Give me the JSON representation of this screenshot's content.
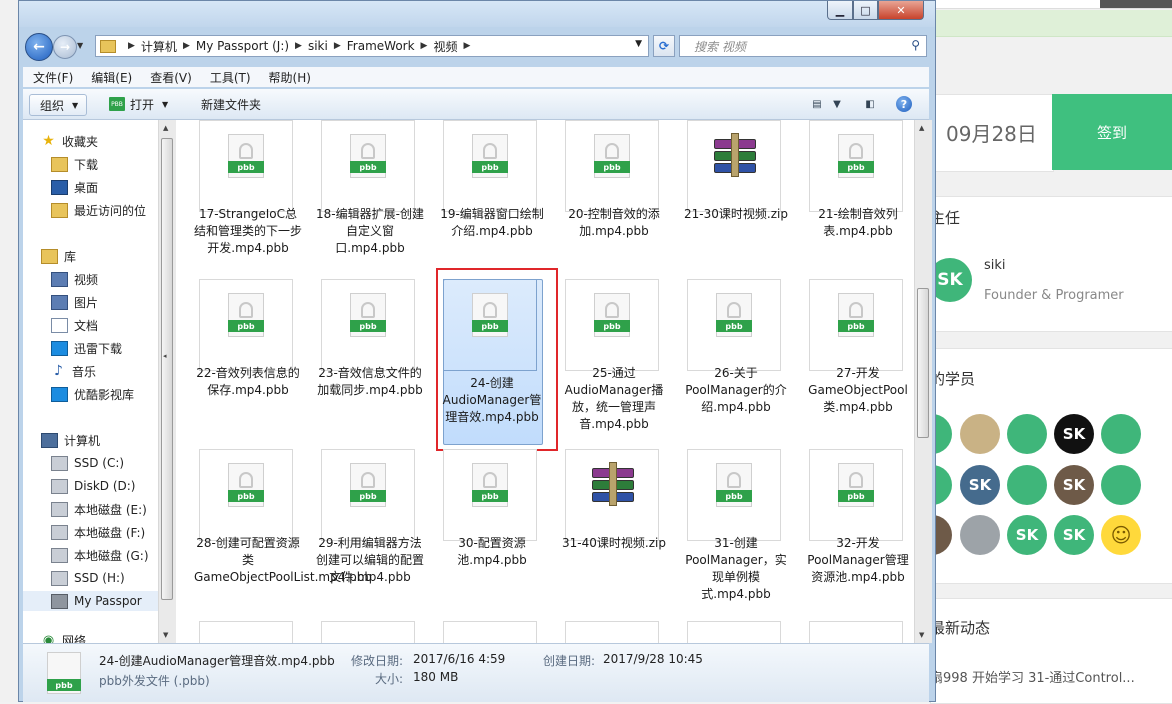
{
  "browser_bg": {
    "date": "09月28日",
    "sign_button": "签到",
    "heading_teacher": "主任",
    "user_name": "siki",
    "user_role": "Founder & Programer",
    "heading_students": "的学员",
    "heading_activity": "最新动态",
    "activity_text": "扇998 开始学习 31-通过Control...",
    "avatars": [
      "SK",
      "",
      "",
      "SK",
      "",
      "SK",
      "SK",
      "",
      "SK",
      "",
      "SK",
      "",
      "SK",
      "SK",
      "☺"
    ]
  },
  "window": {
    "min_label": "▁",
    "max_label": "□",
    "close_label": "✕"
  },
  "address": {
    "crumbs": [
      "计算机",
      "My Passport (J:)",
      "siki",
      "FrameWork",
      "视频"
    ],
    "search_placeholder": "搜索 视频"
  },
  "menu": [
    "文件(F)",
    "编辑(E)",
    "查看(V)",
    "工具(T)",
    "帮助(H)"
  ],
  "toolbar": {
    "organize": "组织",
    "open": "打开",
    "new_folder": "新建文件夹",
    "help": "?"
  },
  "nav": {
    "favorites_title": "收藏夹",
    "favorites": [
      "下载",
      "桌面",
      "最近访问的位"
    ],
    "libraries_title": "库",
    "libraries": [
      "视频",
      "图片",
      "文档",
      "迅雷下载",
      "音乐",
      "优酷影视库"
    ],
    "computer_title": "计算机",
    "drives": [
      "SSD (C:)",
      "DiskD (D:)",
      "本地磁盘 (E:)",
      "本地磁盘 (F:)",
      "本地磁盘 (G:)",
      "SSD (H:)",
      "My Passpor"
    ],
    "network_title": "网络"
  },
  "files": [
    {
      "type": "pbb",
      "label": "17-StrangeIoC总结和管理类的下一步开发.mp4.pbb"
    },
    {
      "type": "pbb",
      "label": "18-编辑器扩展-创建自定义窗口.mp4.pbb"
    },
    {
      "type": "pbb",
      "label": "19-编辑器窗口绘制介绍.mp4.pbb"
    },
    {
      "type": "pbb",
      "label": "20-控制音效的添加.mp4.pbb"
    },
    {
      "type": "zip",
      "label": "21-30课时视频.zip"
    },
    {
      "type": "pbb",
      "label": "21-绘制音效列表.mp4.pbb"
    },
    {
      "type": "pbb",
      "label": "22-音效列表信息的保存.mp4.pbb"
    },
    {
      "type": "pbb",
      "label": "23-音效信息文件的加载同步.mp4.pbb"
    },
    {
      "type": "pbb",
      "label": "24-创建AudioManager管理音效.mp4.pbb",
      "selected": true
    },
    {
      "type": "pbb",
      "label": "25-通过AudioManager播放，统一管理声音.mp4.pbb"
    },
    {
      "type": "pbb",
      "label": "26-关于PoolManager的介绍.mp4.pbb"
    },
    {
      "type": "pbb",
      "label": "27-开发GameObjectPool类.mp4.pbb"
    },
    {
      "type": "pbb",
      "label": "28-创建可配置资源类GameObjectPoolList.mp4.pbb"
    },
    {
      "type": "pbb",
      "label": "29-利用编辑器方法创建可以编辑的配置文件.mp4.pbb"
    },
    {
      "type": "pbb",
      "label": "30-配置资源池.mp4.pbb"
    },
    {
      "type": "zip",
      "label": "31-40课时视频.zip"
    },
    {
      "type": "pbb",
      "label": "31-创建PoolManager，实现单例模式.mp4.pbb"
    },
    {
      "type": "pbb",
      "label": "32-开发PoolManager管理资源池.mp4.pbb"
    }
  ],
  "pbb_tag": "pbb",
  "details": {
    "file_name": "24-创建AudioManager管理音效.mp4.pbb",
    "file_type": "pbb外发文件 (.pbb)",
    "modified_label": "修改日期:",
    "modified_value": "2017/6/16 4:59",
    "created_label": "创建日期:",
    "created_value": "2017/9/28 10:45",
    "size_label": "大小:",
    "size_value": "180 MB"
  },
  "colors": {
    "accent_green": "#2fa14a",
    "selection_outline": "#e0262a",
    "sign_green": "#3fc07f"
  }
}
